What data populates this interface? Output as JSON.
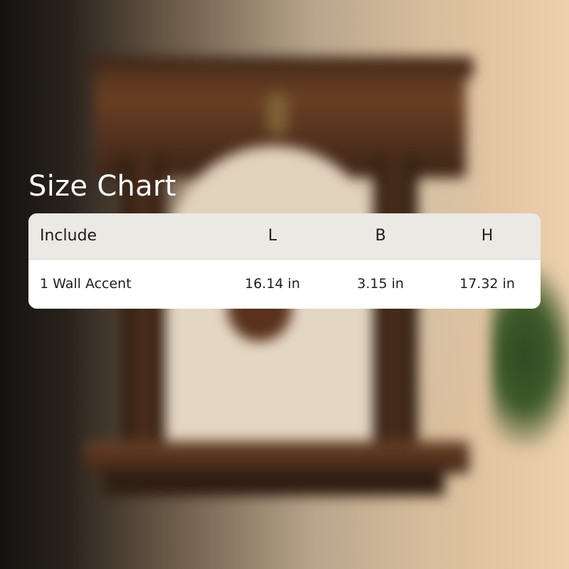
{
  "title": "Size Chart",
  "table": {
    "headers": [
      "Include",
      "L",
      "B",
      "H"
    ],
    "rows": [
      [
        "1 Wall Accent",
        "16.14 in",
        "3.15 in",
        "17.32 in"
      ]
    ]
  }
}
